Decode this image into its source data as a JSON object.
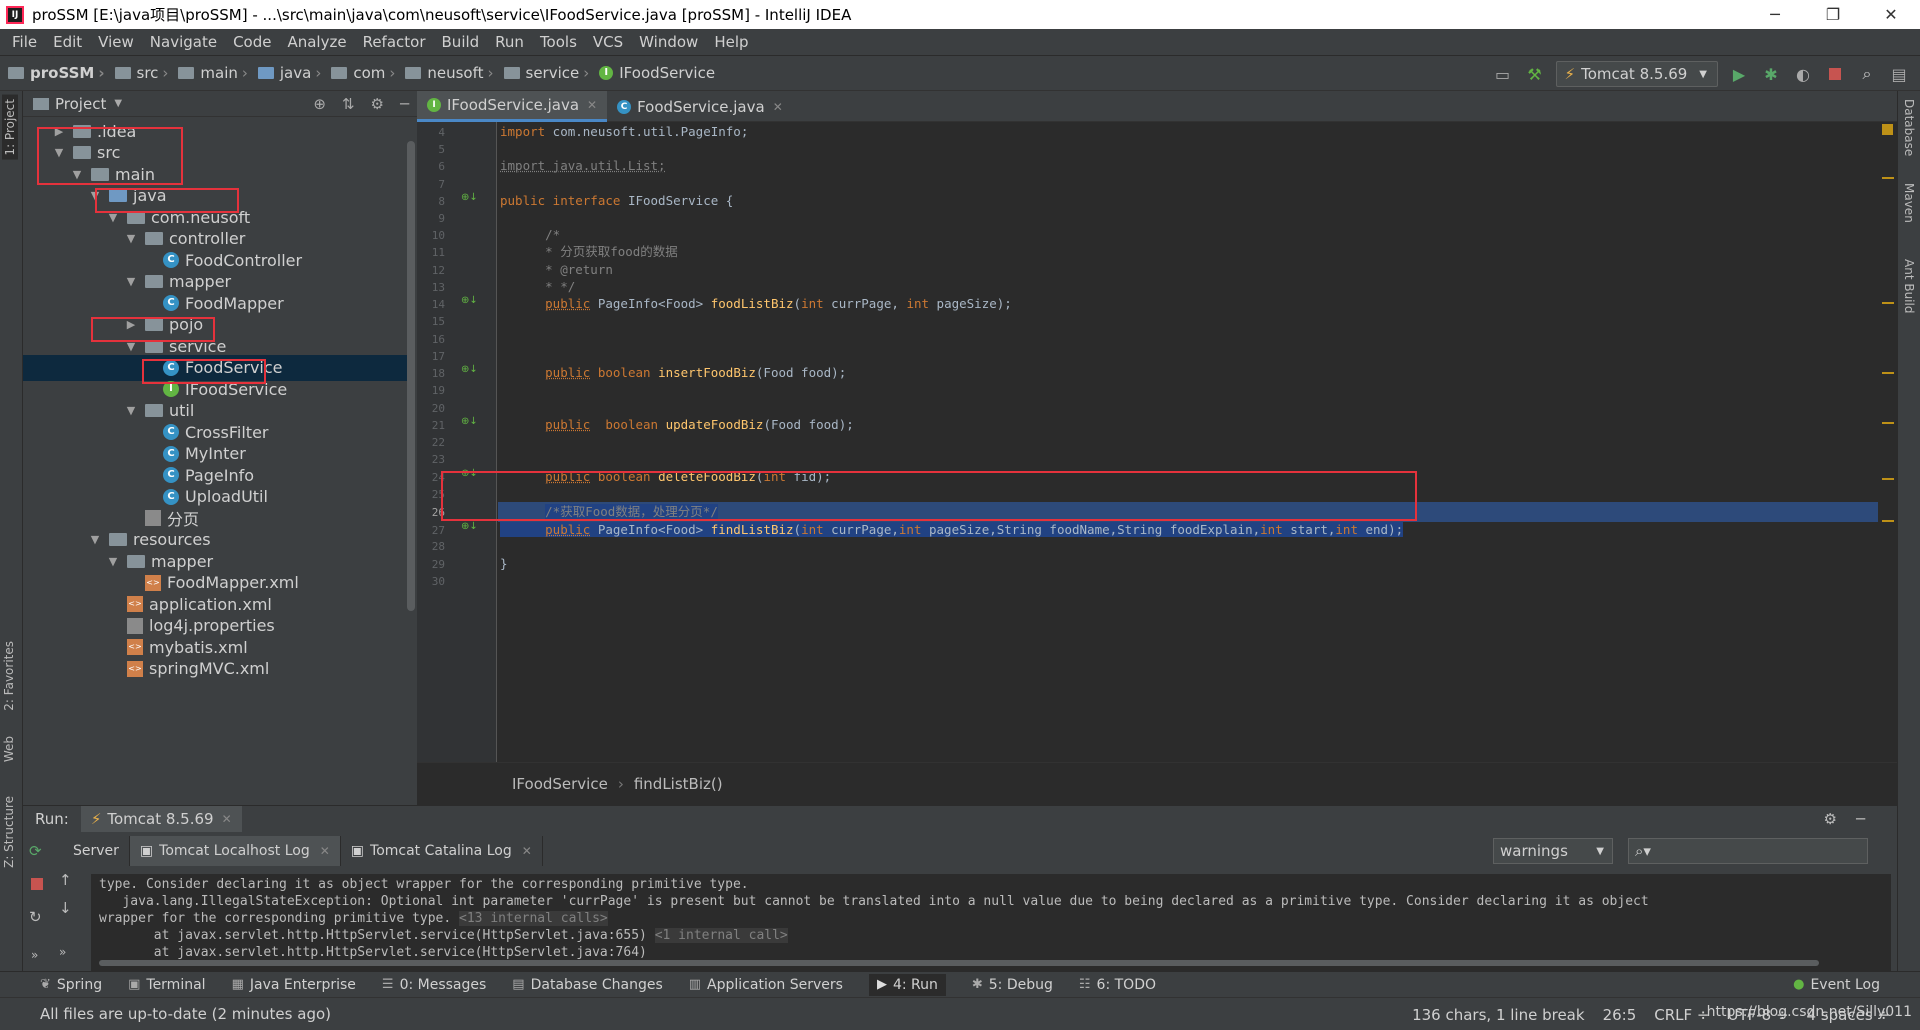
{
  "window": {
    "title": "proSSM [E:\\java项目\\proSSM] - ...\\src\\main\\java\\com\\neusoft\\service\\IFoodService.java [proSSM] - IntelliJ IDEA",
    "app_icon": "IJ",
    "minimize": "─",
    "restore": "❐",
    "close": "✕"
  },
  "menu": [
    "File",
    "Edit",
    "View",
    "Navigate",
    "Code",
    "Analyze",
    "Refactor",
    "Build",
    "Run",
    "Tools",
    "VCS",
    "Window",
    "Help"
  ],
  "navbar": {
    "crumbs": [
      "proSSM",
      "src",
      "main",
      "java",
      "com",
      "neusoft",
      "service",
      "IFoodService"
    ],
    "run_config": "Tomcat 8.5.69"
  },
  "left_tabs": {
    "project": "1: Project",
    "favorites": "2: Favorites",
    "web": "Web",
    "structure": "Z: Structure"
  },
  "right_tabs": {
    "database": "Database",
    "maven": "Maven",
    "ant": "Ant Build"
  },
  "project_panel": {
    "title": "Project",
    "tree": [
      {
        "label": ".idea",
        "arrow": "▶",
        "icon": "folder"
      },
      {
        "label": "src",
        "arrow": "▼",
        "icon": "folder"
      },
      {
        "label": "main",
        "arrow": "▼",
        "icon": "folder"
      },
      {
        "label": "java",
        "arrow": "▼",
        "icon": "folder-blue"
      },
      {
        "label": "com.neusoft",
        "arrow": "▼",
        "icon": "folder"
      },
      {
        "label": "controller",
        "arrow": "▼",
        "icon": "folder"
      },
      {
        "label": "FoodController",
        "arrow": "",
        "icon": "class"
      },
      {
        "label": "mapper",
        "arrow": "▼",
        "icon": "folder"
      },
      {
        "label": "FoodMapper",
        "arrow": "",
        "icon": "class"
      },
      {
        "label": "pojo",
        "arrow": "▶",
        "icon": "folder"
      },
      {
        "label": "service",
        "arrow": "▼",
        "icon": "folder"
      },
      {
        "label": "FoodService",
        "arrow": "",
        "icon": "class"
      },
      {
        "label": "IFoodService",
        "arrow": "",
        "icon": "interface"
      },
      {
        "label": "util",
        "arrow": "▼",
        "icon": "folder"
      },
      {
        "label": "CrossFilter",
        "arrow": "",
        "icon": "class"
      },
      {
        "label": "MyInter",
        "arrow": "",
        "icon": "class"
      },
      {
        "label": "PageInfo",
        "arrow": "",
        "icon": "class"
      },
      {
        "label": "UploadUtil",
        "arrow": "",
        "icon": "class"
      },
      {
        "label": "分页",
        "arrow": "",
        "icon": "file"
      },
      {
        "label": "resources",
        "arrow": "▼",
        "icon": "folder"
      },
      {
        "label": "mapper",
        "arrow": "▼",
        "icon": "folder"
      },
      {
        "label": "FoodMapper.xml",
        "arrow": "",
        "icon": "xml"
      },
      {
        "label": "application.xml",
        "arrow": "",
        "icon": "xml"
      },
      {
        "label": "log4j.properties",
        "arrow": "",
        "icon": "props"
      },
      {
        "label": "mybatis.xml",
        "arrow": "",
        "icon": "xml"
      },
      {
        "label": "springMVC.xml",
        "arrow": "",
        "icon": "xml"
      }
    ]
  },
  "editor": {
    "tabs": [
      {
        "label": "IFoodService.java",
        "icon": "I",
        "color": "#62b543",
        "active": true
      },
      {
        "label": "FoodService.java",
        "icon": "C",
        "color": "#3592c4",
        "active": false
      }
    ],
    "line_numbers": [
      "4",
      "5",
      "6",
      "7",
      "8",
      "9",
      "10",
      "11",
      "12",
      "13",
      "14",
      "15",
      "16",
      "17",
      "18",
      "19",
      "20",
      "21",
      "22",
      "23",
      "24",
      "25",
      "26",
      "27",
      "28",
      "29",
      "30"
    ],
    "current_line": "26",
    "breadcrumb": [
      "IFoodService",
      "findListBiz()"
    ]
  },
  "run_panel": {
    "label": "Run:",
    "config": "Tomcat 8.5.69",
    "subtabs": [
      "Server",
      "Tomcat Localhost Log",
      "Tomcat Catalina Log"
    ],
    "filter": "warnings",
    "console": [
      "type. Consider declaring it as object wrapper for the corresponding primitive type.",
      "   java.lang.IllegalStateException: Optional int parameter 'currPage' is present but cannot be translated into a null value due to being declared as a primitive type. Consider declaring it as object",
      "wrapper for the corresponding primitive type.",
      "       at javax.servlet.http.HttpServlet.service(HttpServlet.java:655)",
      "       at javax.servlet.http.HttpServlet.service(HttpServlet.java:764)"
    ],
    "internal_calls_13": "<13 internal calls>",
    "internal_call_1": "<1 internal call>"
  },
  "toolwindows": [
    "Spring",
    "Terminal",
    "Java Enterprise",
    "0: Messages",
    "Database Changes",
    "Application Servers",
    "4: Run",
    "5: Debug",
    "6: TODO"
  ],
  "event_log": "Event Log",
  "status": {
    "message": "All files are up-to-date (2 minutes ago)",
    "chars": "136 chars, 1 line break",
    "position": "26:5",
    "line_sep": "CRLF ÷",
    "encoding": "UTF-8 ÷",
    "indent": "4 spaces ÷",
    "watermark": "https://blog.csdn.net/Silly011"
  },
  "colors": {
    "keyword": "#cc7832",
    "method": "#ffc66d",
    "comment": "#808080",
    "highlight_box": "#e5323c",
    "selection": "#214283"
  }
}
